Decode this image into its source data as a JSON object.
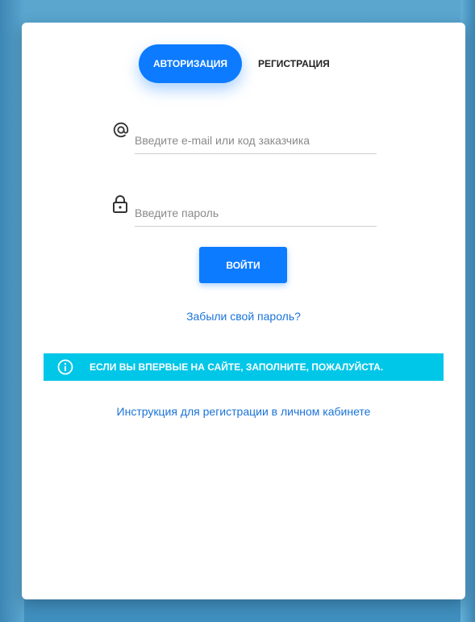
{
  "tabs": {
    "login_label": "АВТОРИЗАЦИЯ",
    "register_label": "РЕГИСТРАЦИЯ"
  },
  "email": {
    "placeholder": "Введите e-mail или код заказчика",
    "value": "",
    "icon": "at-icon"
  },
  "password": {
    "placeholder": "Введите пароль",
    "value": "",
    "icon": "lock-icon"
  },
  "login_button": "ВОЙТИ",
  "forgot_password": "Забыли свой пароль?",
  "info_banner": {
    "icon": "info-icon",
    "text": "ЕСЛИ ВЫ ВПЕРВЫЕ НА САЙТЕ, ЗАПОЛНИТЕ, ПОЖАЛУЙСТА."
  },
  "instruction_link": "Инструкция для регистрации в личном кабинете",
  "colors": {
    "accent": "#0d7bff",
    "info": "#00c6e8",
    "link": "#1a73d9"
  }
}
